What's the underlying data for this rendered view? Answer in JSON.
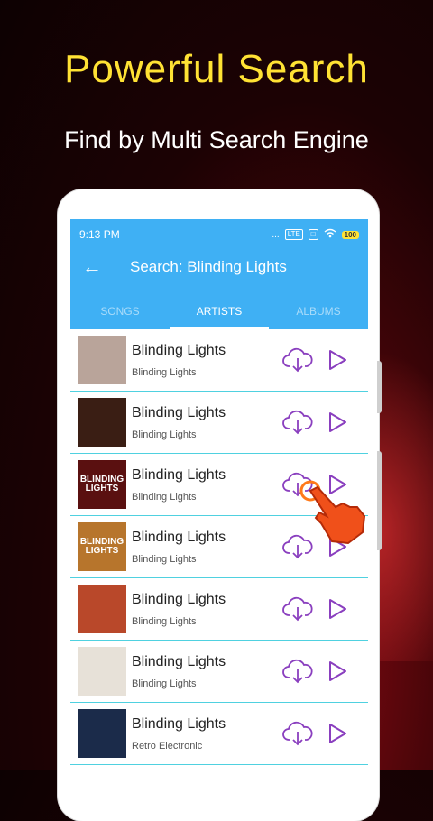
{
  "promo": {
    "headline": "Powerful Search",
    "subline": "Find by Multi Search Engine"
  },
  "statusbar": {
    "time": "9:13 PM",
    "dots": "...",
    "lte_label": "LTE",
    "battery": "100"
  },
  "toolbar": {
    "title": "Search: Blinding Lights"
  },
  "tabs": [
    {
      "label": "SONGS",
      "active": false
    },
    {
      "label": "ARTISTS",
      "active": true
    },
    {
      "label": "ALBUMS",
      "active": false
    }
  ],
  "results": [
    {
      "title": "Blinding Lights",
      "subtitle": "Blinding Lights",
      "thumb_text": "",
      "thumb_color": "#b9a49a"
    },
    {
      "title": "Blinding Lights",
      "subtitle": "Blinding Lights",
      "thumb_text": "",
      "thumb_color": "#3a1e14"
    },
    {
      "title": "Blinding Lights",
      "subtitle": "Blinding Lights",
      "thumb_text": "BLINDING LIGHTS",
      "thumb_color": "#5a1010"
    },
    {
      "title": "Blinding Lights",
      "subtitle": "Blinding Lights",
      "thumb_text": "BLINDING LIGHTS",
      "thumb_color": "#b7752c"
    },
    {
      "title": "Blinding Lights",
      "subtitle": "Blinding Lights",
      "thumb_text": "",
      "thumb_color": "#b9482a"
    },
    {
      "title": "Blinding Lights",
      "subtitle": "Blinding Lights",
      "thumb_text": "",
      "thumb_color": "#e7e1d8"
    },
    {
      "title": "Blinding Lights",
      "subtitle": "Retro Electronic",
      "thumb_text": "",
      "thumb_color": "#1b2b4a"
    }
  ],
  "colors": {
    "accent": "#3fb0f4",
    "headline": "#ffe234",
    "icon_purple": "#8a3fbf",
    "divider": "#4fd1e0"
  }
}
